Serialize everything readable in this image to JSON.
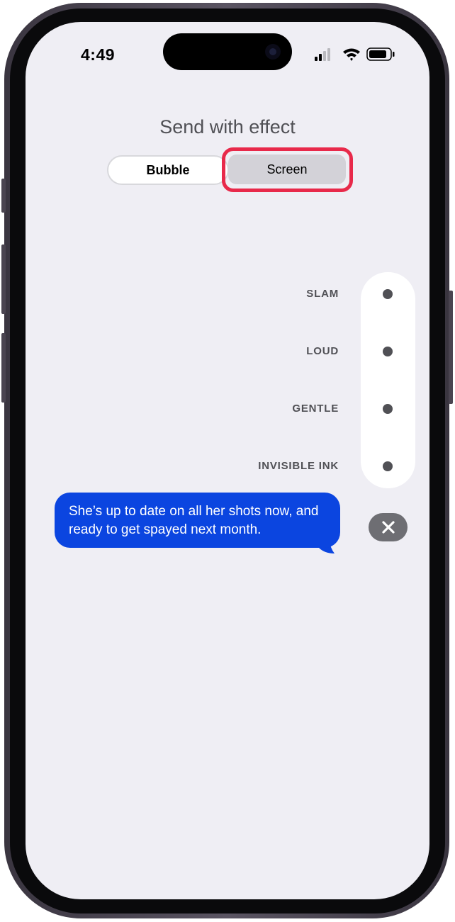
{
  "status_bar": {
    "time": "4:49"
  },
  "sheet": {
    "title": "Send with effect",
    "tabs": [
      {
        "label": "Bubble",
        "selected": false
      },
      {
        "label": "Screen",
        "selected": true
      }
    ],
    "highlight_color": "#e8294a"
  },
  "effects": [
    {
      "label": "SLAM"
    },
    {
      "label": "LOUD"
    },
    {
      "label": "GENTLE"
    },
    {
      "label": "INVISIBLE INK"
    }
  ],
  "message": {
    "text": "She’s up to date on all her shots now, and ready to get spayed next month.",
    "bubble_color": "#0b45e0"
  },
  "icons": {
    "cancel": "close-icon",
    "signal": "cellular-signal-icon",
    "wifi": "wifi-icon",
    "battery": "battery-icon"
  }
}
